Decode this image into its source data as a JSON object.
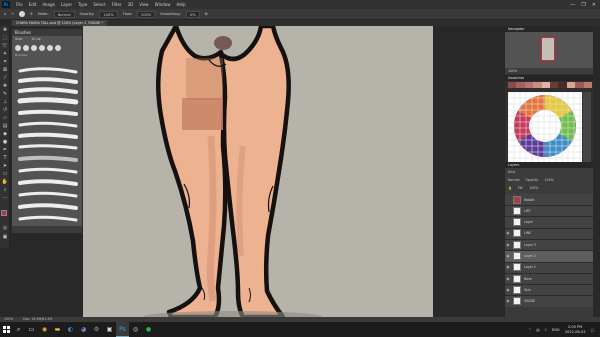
{
  "menubar": {
    "logo": "Ps",
    "items": [
      "File",
      "Edit",
      "Image",
      "Layer",
      "Type",
      "Select",
      "Filter",
      "3D",
      "View",
      "Window",
      "Help"
    ],
    "controls": [
      "—",
      "❐",
      "✕"
    ]
  },
  "optionsbar": {
    "brush_size": "6",
    "mode_label": "Mode:",
    "mode_value": "Normal",
    "opacity_label": "Opacity:",
    "opacity_value": "100%",
    "flow_label": "Flow:",
    "flow_value": "100%",
    "smoothing_label": "Smoothing:",
    "smoothing_value": "0%"
  },
  "document": {
    "tab_title": "CHARA MARIA TALL.psd @ 100% (Layer 2, RGB/8) *"
  },
  "brushes_panel": {
    "title": "Brushes",
    "size_label": "Size:",
    "size_value": "10 px",
    "folder_label": "Brushes"
  },
  "navigator": {
    "title": "Navigator",
    "zoom": "100%"
  },
  "swatches": {
    "title": "Swatches",
    "colors": [
      "#8a4b4b",
      "#a86161",
      "#b87372",
      "#c98f86",
      "#e0b2a3",
      "#6e3a3a",
      "#4e2a2a",
      "#d9a593",
      "#9b5d57",
      "#c07a6a"
    ]
  },
  "layer_tools": {
    "kind_label": "Kind",
    "blend_mode": "Normal",
    "opacity_label": "Opacity:",
    "opacity_value": "100%",
    "fill_label": "Fill:",
    "fill_value": "100%"
  },
  "layers": [
    {
      "name": "Rabbit",
      "visible": false,
      "selected": false,
      "thumb": "#b23a48"
    },
    {
      "name": "LIFE",
      "visible": false,
      "selected": false,
      "thumb": "#f2f2f2"
    },
    {
      "name": "Layer",
      "visible": false,
      "selected": false,
      "thumb": "#f2f2f2"
    },
    {
      "name": "LINE",
      "visible": true,
      "selected": false,
      "thumb": "#f2f2f2"
    },
    {
      "name": "Layer 3",
      "visible": true,
      "selected": false,
      "thumb": "#f2f2f2"
    },
    {
      "name": "Layer 2",
      "visible": true,
      "selected": true,
      "thumb": "#f2f2f2"
    },
    {
      "name": "Layer 1",
      "visible": true,
      "selected": false,
      "thumb": "#f2f2f2"
    },
    {
      "name": "Base",
      "visible": true,
      "selected": false,
      "thumb": "#f2f2f2"
    },
    {
      "name": "Skin",
      "visible": true,
      "selected": false,
      "thumb": "#f2f2f2"
    },
    {
      "name": "SHADE",
      "visible": true,
      "selected": false,
      "thumb": "#f2f2f2"
    }
  ],
  "statusbar": {
    "zoom": "100%",
    "doc_info": "Doc: 18.9M/81.2M"
  },
  "taskbar": {
    "lang": "ENG",
    "time": "2:05 PM",
    "date": "2022-06-03"
  },
  "colors": {
    "skin": "#edb290",
    "skin_shadow": "#d99a7c",
    "skin_dark": "#c88466",
    "blocked_red": "#b77552",
    "outline": "#141110",
    "canvas_bg": "#b6b3ab",
    "fg_color": "#b23a48",
    "bg_color": "#ffffff"
  }
}
